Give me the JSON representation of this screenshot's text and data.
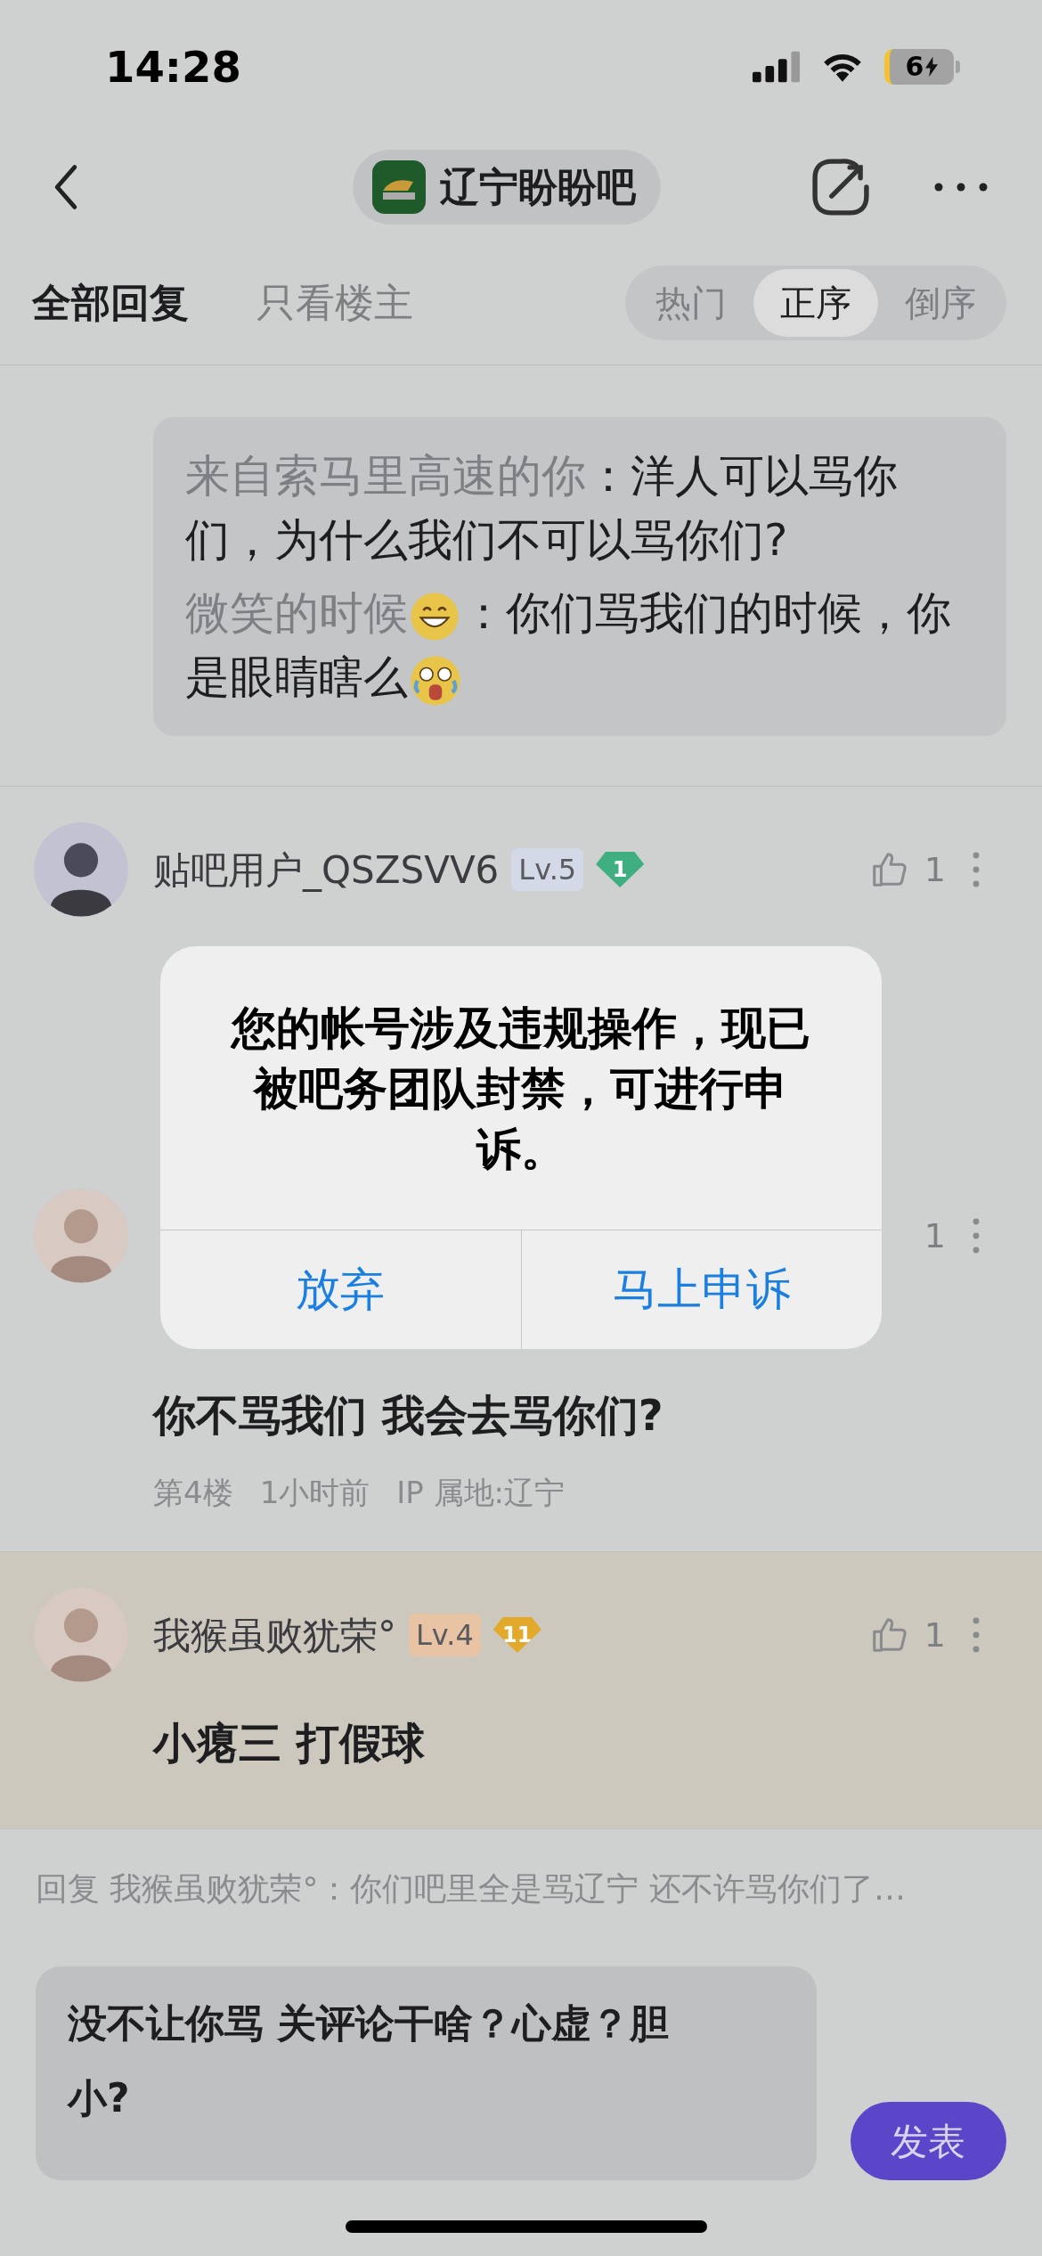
{
  "status_bar": {
    "time": "14:28",
    "battery": "6"
  },
  "nav": {
    "forum_name": "辽宁盼盼吧"
  },
  "tabs": [
    {
      "label": "全部回复",
      "selected": true
    },
    {
      "label": "只看楼主",
      "selected": false
    }
  ],
  "sort_options": [
    {
      "label": "热门",
      "selected": false
    },
    {
      "label": "正序",
      "selected": true
    },
    {
      "label": "倒序",
      "selected": false
    }
  ],
  "quote_replies": [
    {
      "author": "来自索马里高速的你",
      "text": "：洋人可以骂你们，为什么我们不可以骂你们?"
    },
    {
      "author": "微笑的时候",
      "text": "：你们骂我们的时候，你是眼睛瞎么"
    }
  ],
  "comments": [
    {
      "kind": "body_covered",
      "username": "贴吧用户_QSZSVV6",
      "level": {
        "text": "Lv.5",
        "color": "#d3d9e6"
      },
      "badge": {
        "text": "1",
        "color": "#3fae80"
      },
      "likes": "1",
      "highlighted": false
    },
    {
      "kind": "header_covered",
      "likes": "1",
      "body": "你不骂我们 我会去骂你们?",
      "meta": [
        "第4楼",
        "1小时前",
        "IP 属地:辽宁"
      ],
      "highlighted": false
    },
    {
      "kind": "meta_covered",
      "username": "我猴虽败犹荣°",
      "level": {
        "text": "Lv.4",
        "color": "#e8c3a4"
      },
      "badge": {
        "text": "11",
        "color": "#e3a92a"
      },
      "likes": "1",
      "body": "小瘪三 打假球",
      "highlighted": true
    }
  ],
  "reply_bar": {
    "hint": "回复 我猴虽败犹荣°：你们吧里全是骂辽宁 还不许骂你们了…",
    "value": "没不让你骂 关评论干啥？心虚？胆小?",
    "send": "发表"
  },
  "alert": {
    "message": "您的帐号涉及违规操作，现已被吧务团队封禁，可进行申诉。",
    "buttons": [
      {
        "label": "放弃"
      },
      {
        "label": "马上申诉"
      }
    ]
  }
}
